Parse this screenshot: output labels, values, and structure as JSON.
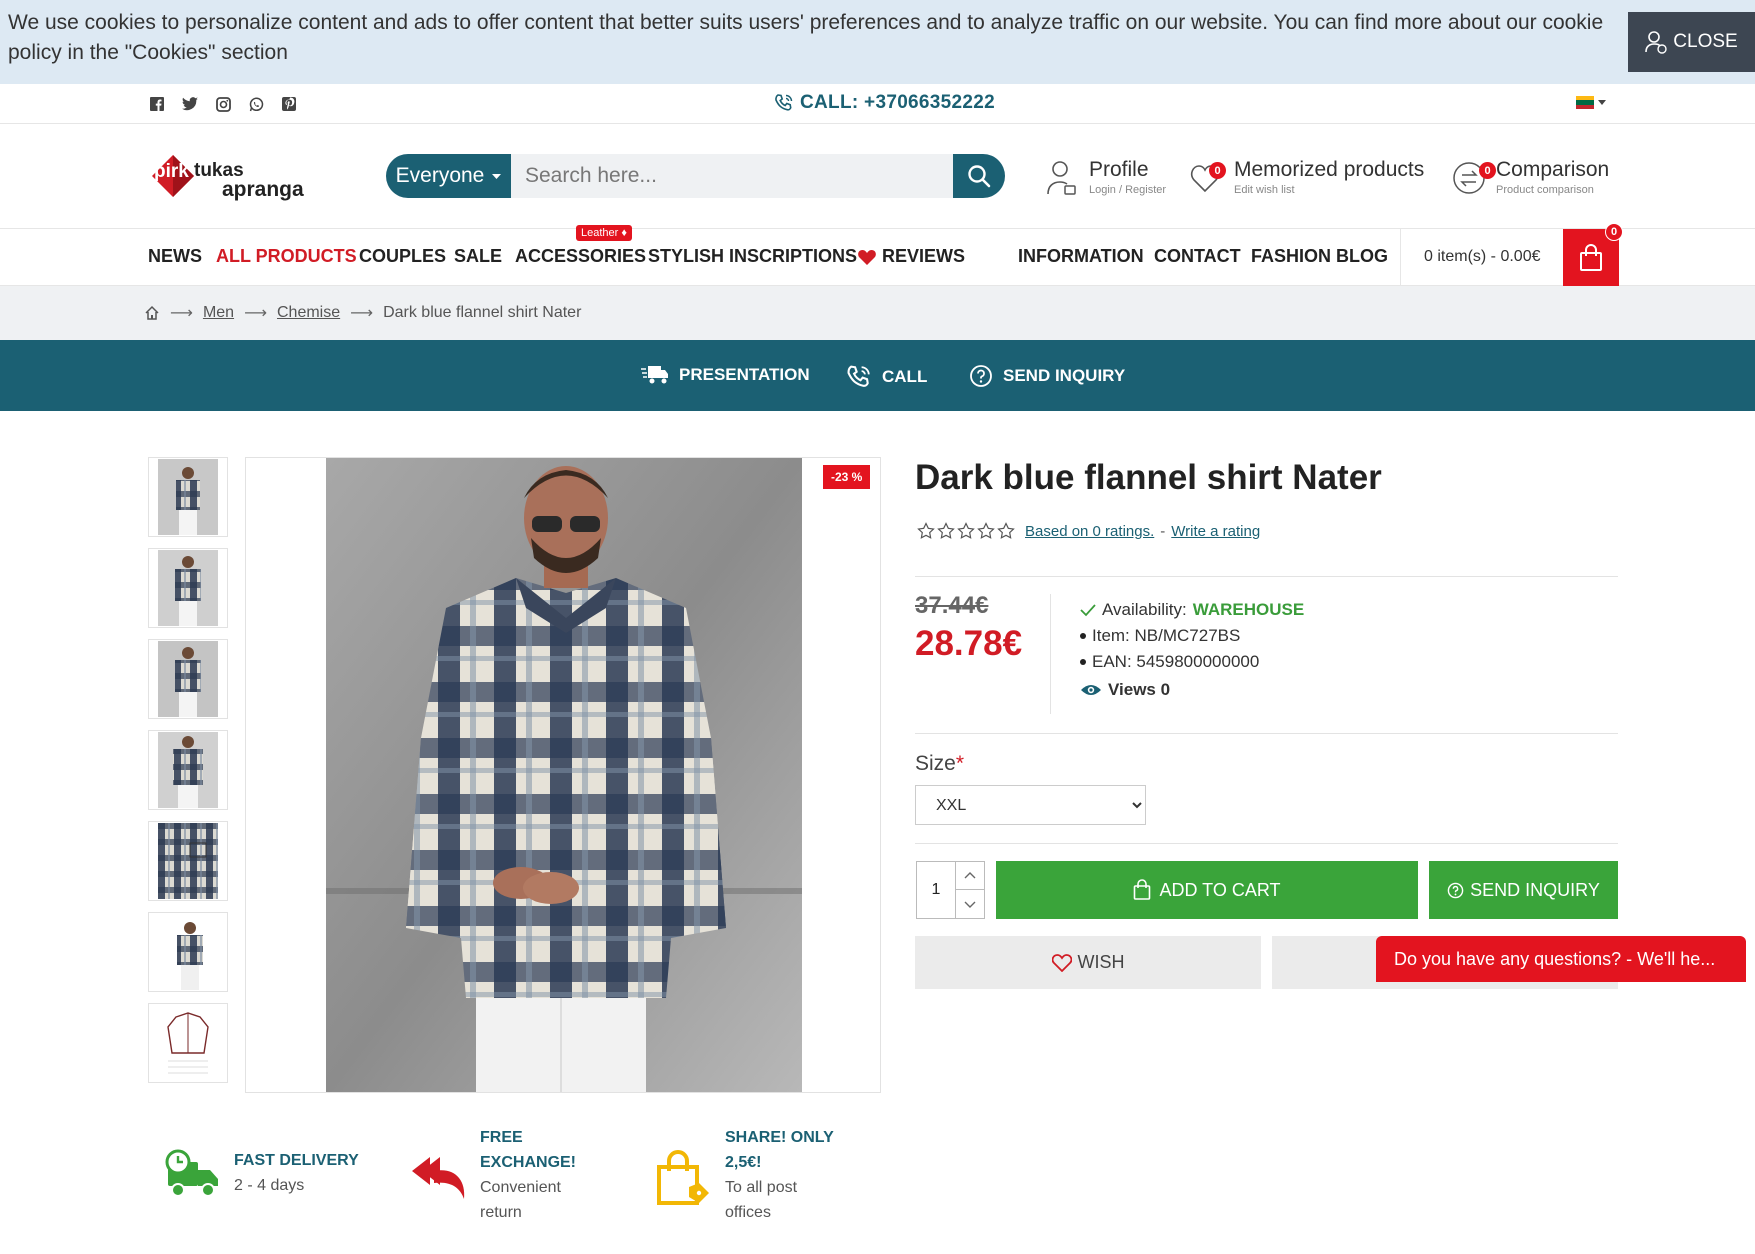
{
  "cookie": {
    "text": "We use cookies to personalize content and ads to offer content that better suits users' preferences and to analyze traffic on our website. You can find more about our cookie policy in the \"Cookies\" section",
    "close_label": "CLOSE"
  },
  "topbar": {
    "phone": "CALL: +37066352222"
  },
  "search": {
    "category": "Everyone",
    "placeholder": "Search here..."
  },
  "header": {
    "profile_title": "Profile",
    "profile_sub": "Login / Register",
    "wish_title": "Memorized products",
    "wish_sub": "Edit wish list",
    "wish_count": "0",
    "compare_title": "Comparison",
    "compare_sub": "Product comparison",
    "compare_count": "0"
  },
  "nav": {
    "items": [
      "NEWS",
      "ALL PRODUCTS",
      "COUPLES",
      "SALE",
      "ACCESSORIES",
      "STYLISH INSCRIPTIONS",
      "REVIEWS",
      "INFORMATION",
      "CONTACT",
      "FASHION BLOG"
    ],
    "accessories_badge": "Leather ♦",
    "cart_text": "0 item(s) - 0.00€",
    "cart_count": "0"
  },
  "breadcrumb": {
    "items": [
      "Men",
      "Chemise",
      "Dark blue flannel shirt Nater"
    ]
  },
  "band": {
    "presentation": "PRESENTATION",
    "call": "CALL",
    "inquiry": "SEND INQUIRY"
  },
  "product": {
    "discount": "-23 %",
    "title": "Dark blue flannel shirt Nater",
    "ratings_text": "Based on 0 ratings.",
    "ratings_sep": "-",
    "write_rating": "Write a rating",
    "old_price": "37.44€",
    "new_price": "28.78€",
    "availability_label": "Availability:",
    "availability_value": "WAREHOUSE",
    "item": "Item: NB/MC727BS",
    "ean": "EAN: 5459800000000",
    "views": "Views 0",
    "size_label": "Size",
    "size_required": "*",
    "size_value": "XXL",
    "quantity": "1",
    "add_to_cart": "ADD TO CART",
    "send_inquiry": "SEND INQUIRY",
    "wish": "WISH"
  },
  "chat": {
    "text": "Do you have any questions? - We'll he..."
  },
  "features": [
    {
      "title": "FAST DELIVERY",
      "sub": "2 - 4 days"
    },
    {
      "title": "FREE EXCHANGE!",
      "sub": "Convenient return"
    },
    {
      "title": "SHARE! ONLY 2,5€!",
      "sub": "To all post offices"
    }
  ],
  "colors": {
    "teal": "#1b6073",
    "red": "#e3141f",
    "green": "#3aa43a"
  }
}
